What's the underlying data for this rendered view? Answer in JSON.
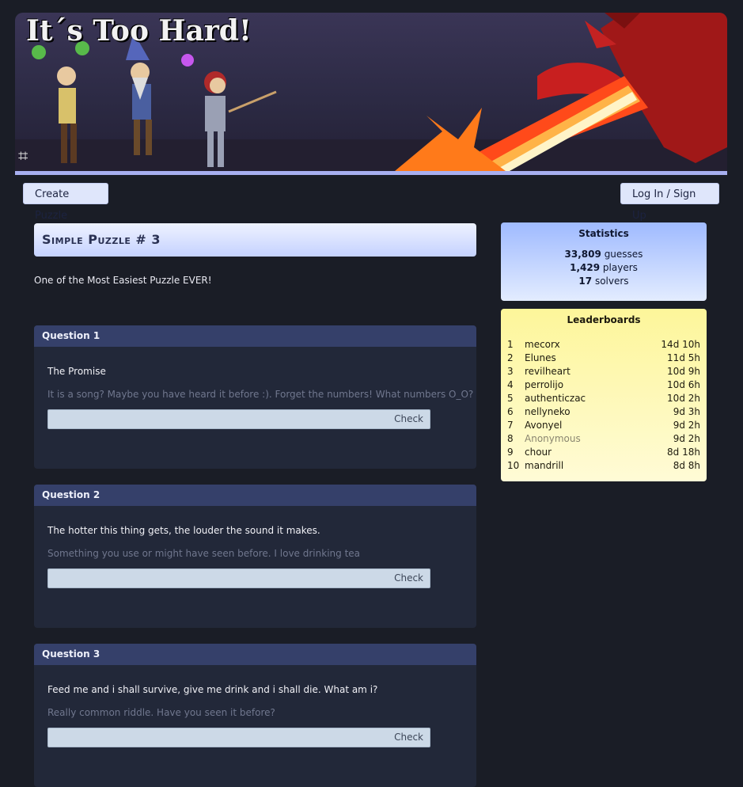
{
  "banner": {
    "title": "It´s Too Hard!"
  },
  "nav": {
    "create_label": "Create Puzzle",
    "login_label": "Log In / Sign Up"
  },
  "puzzle": {
    "title": "Simple Puzzle # 3",
    "description": "One of the Most Easiest Puzzle EVER!"
  },
  "questions": [
    {
      "header": "Question 1",
      "text": "The Promise",
      "hint": "It is a song? Maybe you have heard it before :). Forget the numbers! What numbers O_O?",
      "check_label": "Check",
      "value": ""
    },
    {
      "header": "Question 2",
      "text": "The hotter this thing gets, the louder the sound it makes.",
      "hint": "Something you use or might have seen before. I love drinking tea",
      "check_label": "Check",
      "value": ""
    },
    {
      "header": "Question 3",
      "text": "Feed me and i shall survive, give me drink and i shall die. What am i?",
      "hint": "Really common riddle. Have you seen it before?",
      "check_label": "Check",
      "value": ""
    }
  ],
  "statistics": {
    "title": "Statistics",
    "guesses": "33,809",
    "guesses_label": "guesses",
    "players": "1,429",
    "players_label": "players",
    "solvers": "17",
    "solvers_label": "solvers"
  },
  "leaderboard": {
    "title": "Leaderboards",
    "rows": [
      {
        "rank": "1",
        "name": "mecorx",
        "time": "14d 10h",
        "anonymous": false
      },
      {
        "rank": "2",
        "name": "Elunes",
        "time": "11d 5h",
        "anonymous": false
      },
      {
        "rank": "3",
        "name": "revilheart",
        "time": "10d 9h",
        "anonymous": false
      },
      {
        "rank": "4",
        "name": "perrolijo",
        "time": "10d 6h",
        "anonymous": false
      },
      {
        "rank": "5",
        "name": "authenticzac",
        "time": "10d 2h",
        "anonymous": false
      },
      {
        "rank": "6",
        "name": "nellyneko",
        "time": "9d 3h",
        "anonymous": false
      },
      {
        "rank": "7",
        "name": "Avonyel",
        "time": "9d 2h",
        "anonymous": false
      },
      {
        "rank": "8",
        "name": "Anonymous",
        "time": "9d 2h",
        "anonymous": true
      },
      {
        "rank": "9",
        "name": "chour",
        "time": "8d 18h",
        "anonymous": false
      },
      {
        "rank": "10",
        "name": "mandrill",
        "time": "8d 8h",
        "anonymous": false
      }
    ]
  },
  "colors": {
    "background": "#1a1d26",
    "accent": "#a7aff0",
    "question_header": "#35406a",
    "stats_bg": "#9fbaff",
    "leaderboard_bg": "#fdf69a"
  }
}
